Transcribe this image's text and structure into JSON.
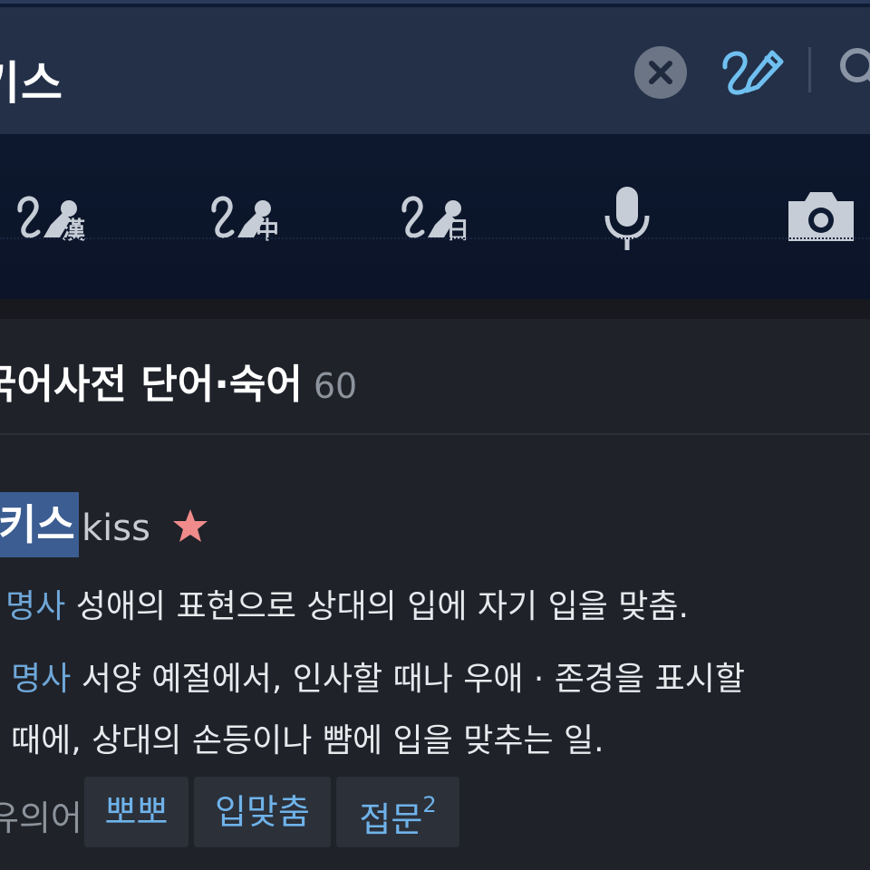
{
  "search": {
    "query": "키스"
  },
  "tools": [
    {
      "name": "hanja-handwriting",
      "label": "漢"
    },
    {
      "name": "chinese-handwriting",
      "label": "中"
    },
    {
      "name": "japanese-handwriting",
      "label": "日"
    },
    {
      "name": "voice-search"
    },
    {
      "name": "camera-search"
    }
  ],
  "section": {
    "title": "국어사전 단어·숙어",
    "count": "60"
  },
  "entry": {
    "headword": "키스",
    "origin": "kiss",
    "senses": [
      {
        "pos": "명사",
        "definition": "성애의 표현으로 상대의 입에 자기 입을 맞춤."
      },
      {
        "pos": "명사",
        "line1": "서양 예절에서, 인사할 때나 우애 · 존경을 표시할",
        "line2": "때에, 상대의 손등이나 뺨에 입을 맞추는 일."
      }
    ],
    "synonyms_label": "유의어",
    "synonyms": [
      {
        "word": "뽀뽀"
      },
      {
        "word": "입맞춤"
      },
      {
        "word": "접문",
        "sup": "2"
      }
    ]
  },
  "colors": {
    "accent": "#6fa7d8",
    "highlight": "#3b5d92",
    "star": "#f08b8b"
  }
}
